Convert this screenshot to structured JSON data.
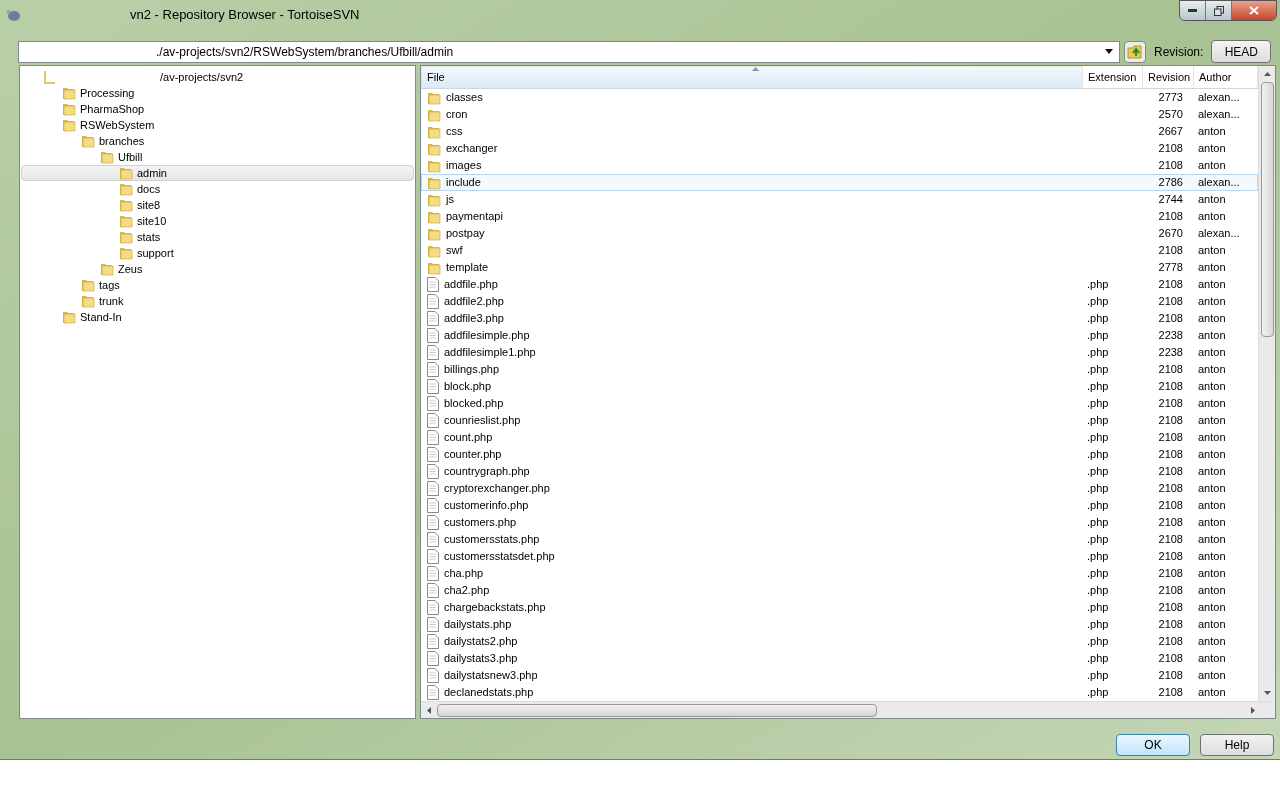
{
  "window": {
    "title": "vn2 - Repository Browser - TortoiseSVN"
  },
  "address": {
    "value": "./av-projects/svn2/RSWebSystem/branches/Ufbill/admin",
    "revision_label": "Revision:",
    "revision_button": "HEAD"
  },
  "tree": {
    "label": "/av-projects/svn2",
    "selected": false,
    "children": [
      {
        "label": "Processing",
        "selected": false
      },
      {
        "label": "PharmaShop",
        "selected": false
      },
      {
        "label": "RSWebSystem",
        "selected": false,
        "children": [
          {
            "label": "branches",
            "selected": false,
            "children": [
              {
                "label": "Ufbill",
                "selected": false,
                "children": [
                  {
                    "label": "admin",
                    "selected": true
                  },
                  {
                    "label": "docs",
                    "selected": false
                  },
                  {
                    "label": "site8",
                    "selected": false
                  },
                  {
                    "label": "site10",
                    "selected": false
                  },
                  {
                    "label": "stats",
                    "selected": false
                  },
                  {
                    "label": "support",
                    "selected": false
                  }
                ]
              },
              {
                "label": "Zeus",
                "selected": false
              }
            ]
          },
          {
            "label": "tags",
            "selected": false
          },
          {
            "label": "trunk",
            "selected": false
          }
        ]
      },
      {
        "label": "Stand-In",
        "selected": false
      }
    ]
  },
  "table": {
    "columns": [
      "File",
      "Extension",
      "Revision",
      "Author"
    ],
    "rows": [
      {
        "kind": "folder",
        "file": "classes",
        "revision": "2773",
        "author": "alexan...",
        "selected": false
      },
      {
        "kind": "folder",
        "file": "cron",
        "revision": "2570",
        "author": "alexan...",
        "selected": false
      },
      {
        "kind": "folder",
        "file": "css",
        "revision": "2667",
        "author": "anton",
        "selected": false
      },
      {
        "kind": "folder",
        "file": "exchanger",
        "revision": "2108",
        "author": "anton",
        "selected": false
      },
      {
        "kind": "folder",
        "file": "images",
        "revision": "2108",
        "author": "anton",
        "selected": false
      },
      {
        "kind": "folder",
        "file": "include",
        "revision": "2786",
        "author": "alexan...",
        "selected": true
      },
      {
        "kind": "folder",
        "file": "js",
        "revision": "2744",
        "author": "anton",
        "selected": false
      },
      {
        "kind": "folder",
        "file": "paymentapi",
        "revision": "2108",
        "author": "anton",
        "selected": false
      },
      {
        "kind": "folder",
        "file": "postpay",
        "revision": "2670",
        "author": "alexan...",
        "selected": false
      },
      {
        "kind": "folder",
        "file": "swf",
        "revision": "2108",
        "author": "anton",
        "selected": false
      },
      {
        "kind": "folder",
        "file": "template",
        "revision": "2778",
        "author": "anton",
        "selected": false
      },
      {
        "kind": "file",
        "file": "addfile.php",
        "extension": ".php",
        "revision": "2108",
        "author": "anton",
        "selected": false
      },
      {
        "kind": "file",
        "file": "addfile2.php",
        "extension": ".php",
        "revision": "2108",
        "author": "anton",
        "selected": false
      },
      {
        "kind": "file",
        "file": "addfile3.php",
        "extension": ".php",
        "revision": "2108",
        "author": "anton",
        "selected": false
      },
      {
        "kind": "file",
        "file": "addfilesimple.php",
        "extension": ".php",
        "revision": "2238",
        "author": "anton",
        "selected": false
      },
      {
        "kind": "file",
        "file": "addfilesimple1.php",
        "extension": ".php",
        "revision": "2238",
        "author": "anton",
        "selected": false
      },
      {
        "kind": "file",
        "file": "billings.php",
        "extension": ".php",
        "revision": "2108",
        "author": "anton",
        "selected": false
      },
      {
        "kind": "file",
        "file": "block.php",
        "extension": ".php",
        "revision": "2108",
        "author": "anton",
        "selected": false
      },
      {
        "kind": "file",
        "file": "blocked.php",
        "extension": ".php",
        "revision": "2108",
        "author": "anton",
        "selected": false
      },
      {
        "kind": "file",
        "file": "counrieslist.php",
        "extension": ".php",
        "revision": "2108",
        "author": "anton",
        "selected": false
      },
      {
        "kind": "file",
        "file": "count.php",
        "extension": ".php",
        "revision": "2108",
        "author": "anton",
        "selected": false
      },
      {
        "kind": "file",
        "file": "counter.php",
        "extension": ".php",
        "revision": "2108",
        "author": "anton",
        "selected": false
      },
      {
        "kind": "file",
        "file": "countrygraph.php",
        "extension": ".php",
        "revision": "2108",
        "author": "anton",
        "selected": false
      },
      {
        "kind": "file",
        "file": "cryptorexchanger.php",
        "extension": ".php",
        "revision": "2108",
        "author": "anton",
        "selected": false
      },
      {
        "kind": "file",
        "file": "customerinfo.php",
        "extension": ".php",
        "revision": "2108",
        "author": "anton",
        "selected": false
      },
      {
        "kind": "file",
        "file": "customers.php",
        "extension": ".php",
        "revision": "2108",
        "author": "anton",
        "selected": false
      },
      {
        "kind": "file",
        "file": "customersstats.php",
        "extension": ".php",
        "revision": "2108",
        "author": "anton",
        "selected": false
      },
      {
        "kind": "file",
        "file": "customersstatsdet.php",
        "extension": ".php",
        "revision": "2108",
        "author": "anton",
        "selected": false
      },
      {
        "kind": "file",
        "file": "cha.php",
        "extension": ".php",
        "revision": "2108",
        "author": "anton",
        "selected": false
      },
      {
        "kind": "file",
        "file": "cha2.php",
        "extension": ".php",
        "revision": "2108",
        "author": "anton",
        "selected": false
      },
      {
        "kind": "file",
        "file": "chargebackstats.php",
        "extension": ".php",
        "revision": "2108",
        "author": "anton",
        "selected": false
      },
      {
        "kind": "file",
        "file": "dailystats.php",
        "extension": ".php",
        "revision": "2108",
        "author": "anton",
        "selected": false
      },
      {
        "kind": "file",
        "file": "dailystats2.php",
        "extension": ".php",
        "revision": "2108",
        "author": "anton",
        "selected": false
      },
      {
        "kind": "file",
        "file": "dailystats3.php",
        "extension": ".php",
        "revision": "2108",
        "author": "anton",
        "selected": false
      },
      {
        "kind": "file",
        "file": "dailystatsnew3.php",
        "extension": ".php",
        "revision": "2108",
        "author": "anton",
        "selected": false
      },
      {
        "kind": "file",
        "file": "declanedstats.php",
        "extension": ".php",
        "revision": "2108",
        "author": "anton",
        "selected": false
      }
    ]
  },
  "buttons": [
    "OK",
    "Help"
  ]
}
